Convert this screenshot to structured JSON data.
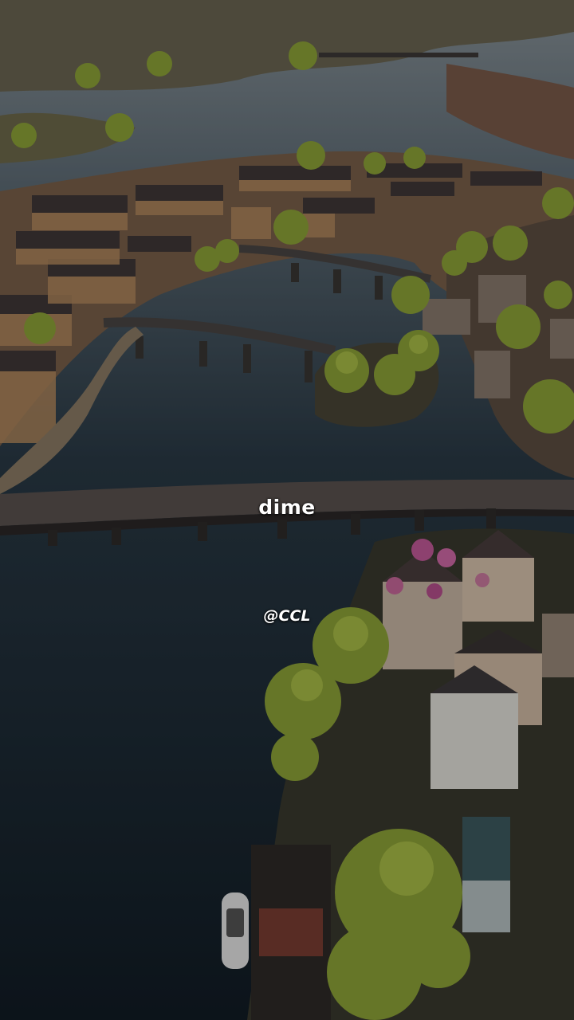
{
  "video": {
    "caption": "dime",
    "watermark": "@CCL"
  },
  "scene": {
    "description_icon": "aerial-city-river-icon",
    "colors": {
      "water": "#1b2a36",
      "water_light": "#6d7c86",
      "buildings": "#8a6a4e",
      "roofs": "#3b3536",
      "trees": "#8fa83a",
      "bridge": "#55504e"
    }
  }
}
